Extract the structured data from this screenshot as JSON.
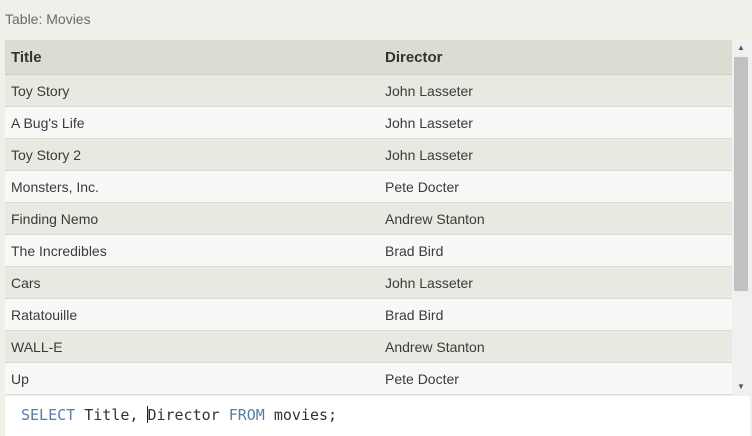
{
  "caption": "Table: Movies",
  "table": {
    "columns": [
      "Title",
      "Director"
    ],
    "rows": [
      [
        "Toy Story",
        "John Lasseter"
      ],
      [
        "A Bug's Life",
        "John Lasseter"
      ],
      [
        "Toy Story 2",
        "John Lasseter"
      ],
      [
        "Monsters, Inc.",
        "Pete Docter"
      ],
      [
        "Finding Nemo",
        "Andrew Stanton"
      ],
      [
        "The Incredibles",
        "Brad Bird"
      ],
      [
        "Cars",
        "John Lasseter"
      ],
      [
        "Ratatouille",
        "Brad Bird"
      ],
      [
        "WALL-E",
        "Andrew Stanton"
      ],
      [
        "Up",
        "Pete Docter"
      ]
    ]
  },
  "query": {
    "kw_select": "SELECT",
    "cols_before_caret": " Title, ",
    "cols_after_caret": "Director ",
    "kw_from": "FROM",
    "tail": " movies;"
  },
  "icons": {
    "scroll_up": "scroll-up-arrow-icon",
    "scroll_down": "scroll-down-arrow-icon"
  },
  "colors": {
    "keyword": "#5a7aa8",
    "header_bg": "#dddcd2",
    "row_odd": "#e9e9e2",
    "row_even": "#f8f8f6",
    "page_bg": "#f0efe9"
  }
}
